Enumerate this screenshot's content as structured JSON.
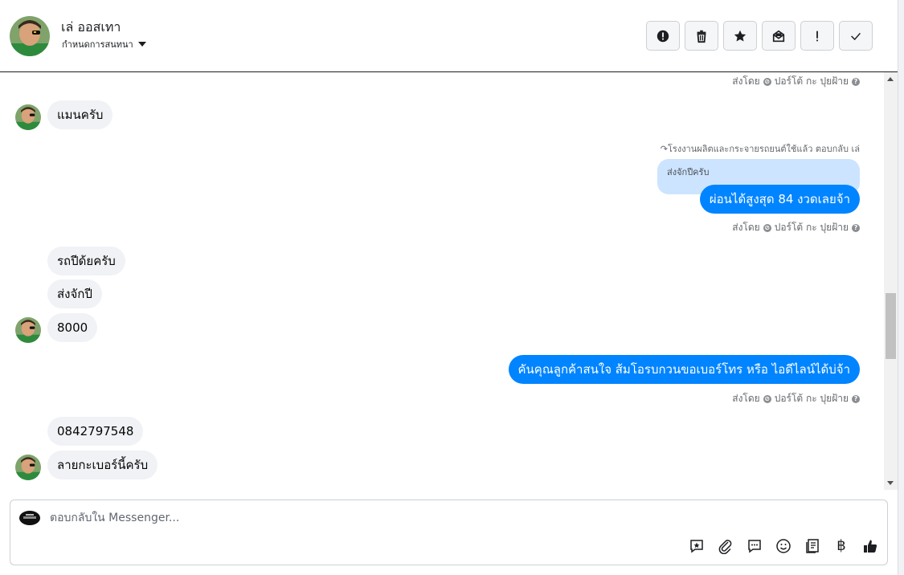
{
  "header": {
    "contact_name": "เล่ ออสเทา",
    "assign_label": "กำหนดการสนทนา",
    "actions": [
      {
        "name": "mark-spam-button",
        "icon": "alert-circle-icon"
      },
      {
        "name": "delete-button",
        "icon": "trash-icon"
      },
      {
        "name": "star-button",
        "icon": "star-icon"
      },
      {
        "name": "mark-unread-button",
        "icon": "envelope-open-icon"
      },
      {
        "name": "priority-button",
        "icon": "exclamation-icon"
      },
      {
        "name": "mark-done-button",
        "icon": "checkmark-icon"
      }
    ]
  },
  "thread": {
    "sent_by_label": "ส่งโดย",
    "sender_name": "ปอร์โต้ กะ ปุยฝ้าย",
    "reply_note": "โรงงานผลิตและกระจายรถยนต์ใช้แล้ว ตอบกลับ เล่",
    "quoted_text": "ส่งจักปีครับ",
    "messages": {
      "in_1": "แมนครับ",
      "out_1": "ผ่อนได้สูงสุด 84 งวดเลยจ้า",
      "in_2": "รถปีด้ยครับ",
      "in_3": "ส่งจักปี",
      "in_4": "8000",
      "out_2": "คันคุณลูกค้าสนใจ ส้มโอรบกวนขอเบอร์โทร หรือ ไอดีไลน์ได้บ่จ้า",
      "in_5": "0842797548",
      "in_6": "ลายกะเบอร์นี้ครับ"
    }
  },
  "composer": {
    "placeholder": "ตอบกลับใน Messenger...",
    "value": "",
    "tools": [
      "saved-reply-icon",
      "attachment-icon",
      "chat-bubble-icon",
      "emoji-icon",
      "notes-icon",
      "baht-icon",
      "thumbs-up-icon"
    ],
    "baht_symbol": "฿"
  },
  "colors": {
    "accent": "#0084ff",
    "incoming_bubble": "#f0f2f5",
    "quote_bubble": "#cce4ff"
  }
}
